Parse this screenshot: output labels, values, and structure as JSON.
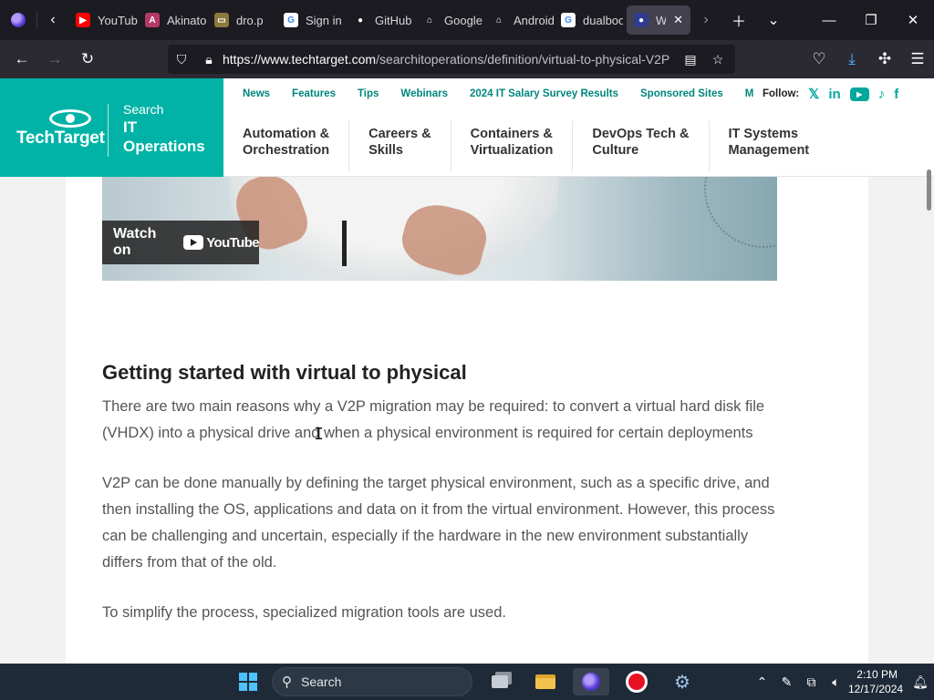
{
  "tabs": [
    {
      "label": "YouTube",
      "favicon_bg": "#ff0000",
      "glyph": "▶"
    },
    {
      "label": "Akinator",
      "favicon_bg": "#b33a67",
      "glyph": "A"
    },
    {
      "label": "dro.p",
      "favicon_bg": "#8a7a3c",
      "glyph": "▭"
    },
    {
      "label": "Sign in",
      "favicon_bg": "#ffffff",
      "glyph": "G"
    },
    {
      "label": "GitHub",
      "favicon_bg": "#1c1b22",
      "glyph": "●"
    },
    {
      "label": "Google",
      "favicon_bg": "#1c1b22",
      "glyph": "⌂"
    },
    {
      "label": "Android",
      "favicon_bg": "#1c1b22",
      "glyph": "⌂"
    },
    {
      "label": "dualboot",
      "favicon_bg": "#ffffff",
      "glyph": "G"
    },
    {
      "label": "Wh",
      "favicon_bg": "#2f3c8c",
      "glyph": "●",
      "active": true
    }
  ],
  "browser": {
    "url_host": "https://www.techtarget.com",
    "url_path": "/searchitoperations/definition/virtual-to-physical-V2P"
  },
  "site": {
    "logo_text": "TechTarget",
    "search_label": "Search",
    "section_line1": "IT",
    "section_line2": "Operations",
    "top_links": [
      "News",
      "Features",
      "Tips",
      "Webinars",
      "2024 IT Salary Survey Results",
      "Sponsored Sites",
      "M"
    ],
    "follow_label": "Follow:",
    "social_icons": [
      "x-icon",
      "linkedin-icon",
      "youtube-icon",
      "tiktok-icon",
      "facebook-icon"
    ],
    "topics": [
      {
        "line1": "Automation &",
        "line2": "Orchestration"
      },
      {
        "line1": "Careers &",
        "line2": "Skills"
      },
      {
        "line1": "Containers &",
        "line2": "Virtualization"
      },
      {
        "line1": "DevOps Tech &",
        "line2": "Culture"
      },
      {
        "line1": "IT Systems",
        "line2": "Management"
      }
    ],
    "accent_color": "#00b3a6",
    "link_color": "#00867d"
  },
  "video": {
    "watch_label": "Watch on",
    "youtube_label": "YouTube"
  },
  "article": {
    "heading": "Getting started with virtual to physical",
    "paragraphs": [
      "There are two main reasons why a V2P migration may be required: to convert a virtual hard disk file (VHDX) into a physical drive and when a physical environment is required for certain deployments",
      "V2P can be done manually by defining the target physical environment, such as a specific drive, and then installing the OS, applications and data on it from the virtual environment. However, this process can be challenging and uncertain, especially if the hardware in the new environment substantially differs from that of the old.",
      "To simplify the process, specialized migration tools are used."
    ]
  },
  "taskbar": {
    "search_placeholder": "Search",
    "time": "2:10 PM",
    "date": "12/17/2024"
  }
}
